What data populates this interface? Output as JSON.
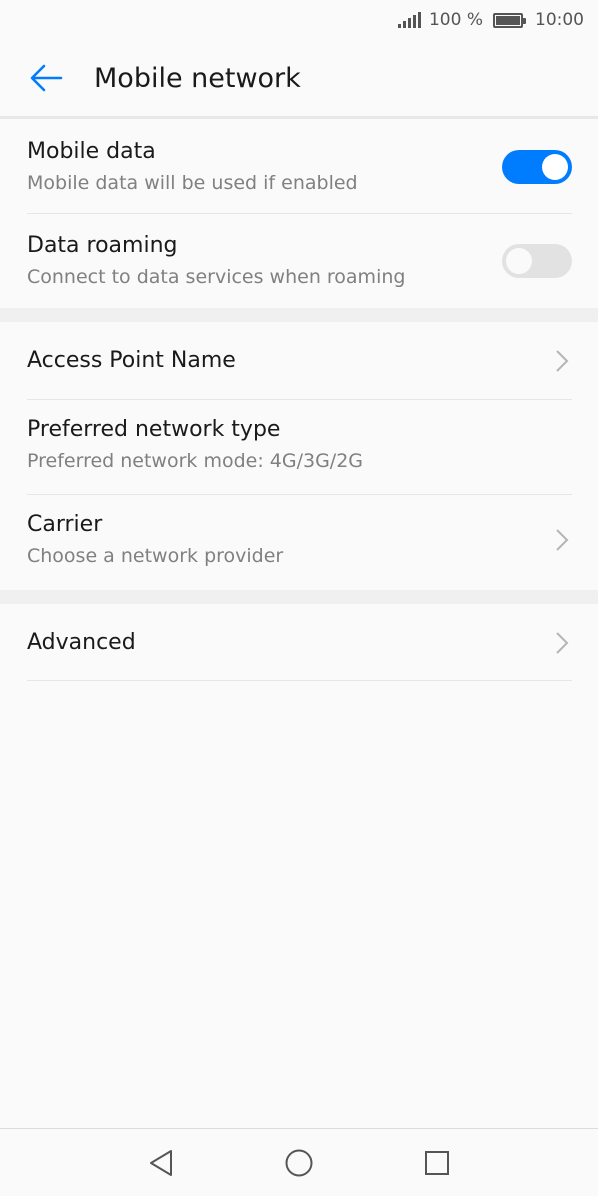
{
  "status_bar": {
    "battery_text": "100 %",
    "time": "10:00",
    "icons": [
      "signal-icon",
      "battery-icon"
    ]
  },
  "header": {
    "title": "Mobile network",
    "back_icon": "arrow-left-icon"
  },
  "colors": {
    "accent": "#007dff",
    "toggle_off": "#e2e2e2",
    "secondary_text": "#808080"
  },
  "settings": {
    "mobile_data": {
      "label": "Mobile data",
      "description": "Mobile data will be used if enabled",
      "enabled": true
    },
    "data_roaming": {
      "label": "Data roaming",
      "description": "Connect to data services when roaming",
      "enabled": false
    },
    "access_point_name": {
      "label": "Access Point Name"
    },
    "preferred_network_type": {
      "label": "Preferred network type",
      "description": "Preferred network mode: 4G/3G/2G"
    },
    "carrier": {
      "label": "Carrier",
      "description": "Choose a network provider"
    },
    "advanced": {
      "label": "Advanced"
    }
  },
  "nav_bar": {
    "icons": [
      "back-triangle-icon",
      "home-circle-icon",
      "recents-square-icon"
    ]
  }
}
